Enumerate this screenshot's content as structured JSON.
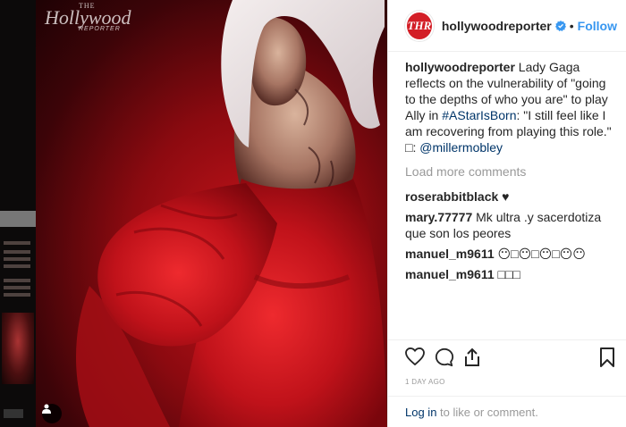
{
  "post": {
    "logo": {
      "the": "THE",
      "name": "Hollywood",
      "tag": "REPORTER"
    },
    "header": {
      "avatar_text": "THR",
      "username": "hollywoodreporter",
      "separator": "•",
      "follow_label": "Follow"
    },
    "caption": {
      "username": "hollywoodreporter",
      "text_before": " Lady Gaga reflects on the vulnerability of \"going to the depths of who you are\" to play Ally in ",
      "hashtag": "#AStarIsBorn",
      "text_after": ": \"I still feel like I am recovering from playing this role.\" □: ",
      "mention": "@millermobley"
    },
    "load_more": "Load more comments",
    "comments": [
      {
        "username": "roserabbitblack",
        "text": " ♥"
      },
      {
        "username": "mary.77777",
        "text": " Mk ultra .y sacerdotiza que son los peores"
      },
      {
        "username": "manuel_m9611",
        "text": " 😶□😶□😶□😶😶"
      },
      {
        "username": "manuel_m9611",
        "text": " □□□"
      }
    ],
    "timestamp": "1 DAY AGO",
    "login": {
      "link": "Log in",
      "rest": " to like or comment."
    },
    "icons": {
      "like": "heart-icon",
      "comment": "comment-icon",
      "share": "share-icon",
      "save": "bookmark-icon",
      "verified": "verified-badge-icon",
      "user_tag": "user-tag-icon"
    },
    "colors": {
      "accent": "#3897f0",
      "brand": "#d31e26",
      "dress": "#c8141b"
    }
  }
}
